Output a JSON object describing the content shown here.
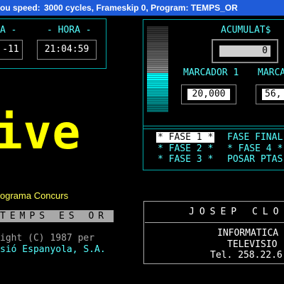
{
  "titlebar": {
    "speed_label": "ou speed:",
    "cycles_text": "3000 cycles, Frameskip  0, Program: TEMPS_OR"
  },
  "date": {
    "label": "A -",
    "value": "-11"
  },
  "hora": {
    "label": "- HORA -",
    "value": "21:04:59"
  },
  "meter": {
    "colors": [
      "#2e2e2e",
      "#3a3a3a",
      "#4a4a4a",
      "#5c5c5c",
      "#6e6e6e",
      "#848484",
      "#00ffff",
      "#00e0e0",
      "#00b8b8",
      "#008f8f",
      "#007070"
    ]
  },
  "acumulat": {
    "label": "ACUMULAT$",
    "value": "0"
  },
  "marcador1": {
    "label": "MARCADOR 1",
    "value": "20,000"
  },
  "marcador2": {
    "label": "MARCA",
    "value": "56,"
  },
  "big_text": "ive",
  "programa": "ograma Concurs",
  "temps_bar": "TEMPS ES OR",
  "copyright": {
    "line1": "ight (C) 1987 per",
    "line2": "sió Espanyola, S.A."
  },
  "menu": {
    "left": [
      "* FASE 1 *",
      "* FASE 2 *",
      "* FASE 3 *"
    ],
    "right": [
      "FASE FINAL",
      "* FASE 4 *",
      "POSAR PTAS"
    ]
  },
  "credits": {
    "name": "JOSEP CLO",
    "line1": "INFORMATICA I",
    "line2": "TELEVISIO",
    "line3": "Tel.  258.22.6"
  }
}
